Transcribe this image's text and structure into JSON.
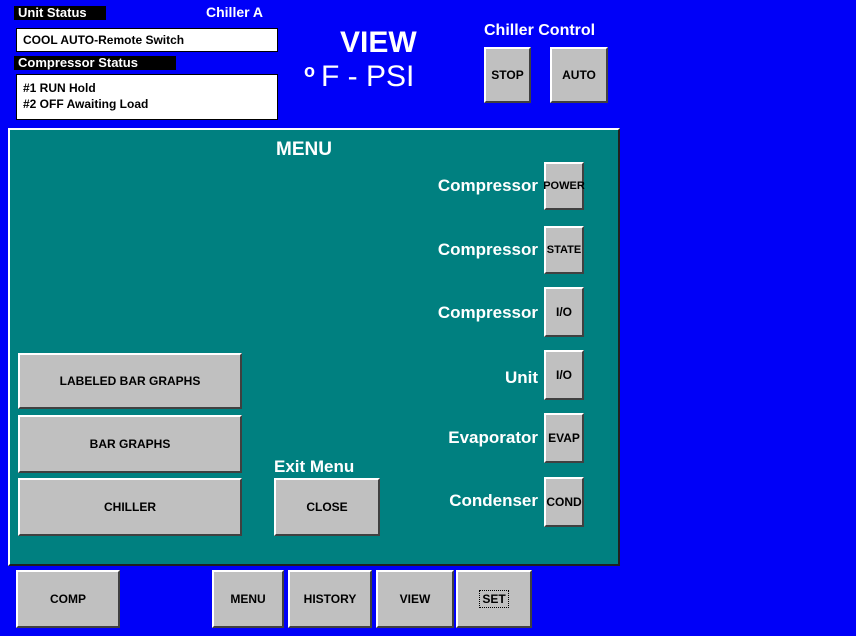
{
  "unit_status": {
    "label": "Unit Status",
    "chiller_name": "Chiller A",
    "value": "COOL  AUTO-Remote Switch"
  },
  "compressor_status": {
    "label": "Compressor Status",
    "line1": "#1 RUN Hold",
    "line2": "#2 OFF Awaiting Load"
  },
  "view": {
    "title": "VIEW",
    "units_degree": "o",
    "units": "F - PSI"
  },
  "chiller_control": {
    "title": "Chiller Control",
    "stop_label": "STOP",
    "auto_label": "AUTO"
  },
  "menu": {
    "title": "MENU",
    "rows": [
      {
        "label": "Compressor",
        "button": "POWER"
      },
      {
        "label": "Compressor",
        "button": "STATE"
      },
      {
        "label": "Compressor",
        "button": "I/O"
      },
      {
        "label": "Unit",
        "button": "I/O"
      },
      {
        "label": "Evaporator",
        "button": "EVAP"
      },
      {
        "label": "Condenser",
        "button": "COND"
      }
    ],
    "left_buttons": {
      "labeled_bar_graphs": "LABELED BAR GRAPHS",
      "bar_graphs": "BAR GRAPHS",
      "chiller": "CHILLER"
    },
    "exit_label": "Exit Menu",
    "close_label": "CLOSE"
  },
  "bottom_nav": {
    "comp": "COMP",
    "menu": "MENU",
    "history": "HISTORY",
    "view": "VIEW",
    "set": "SET"
  },
  "colors": {
    "background": "#0000f8",
    "panel": "#008080",
    "button": "#c0c0c0"
  }
}
